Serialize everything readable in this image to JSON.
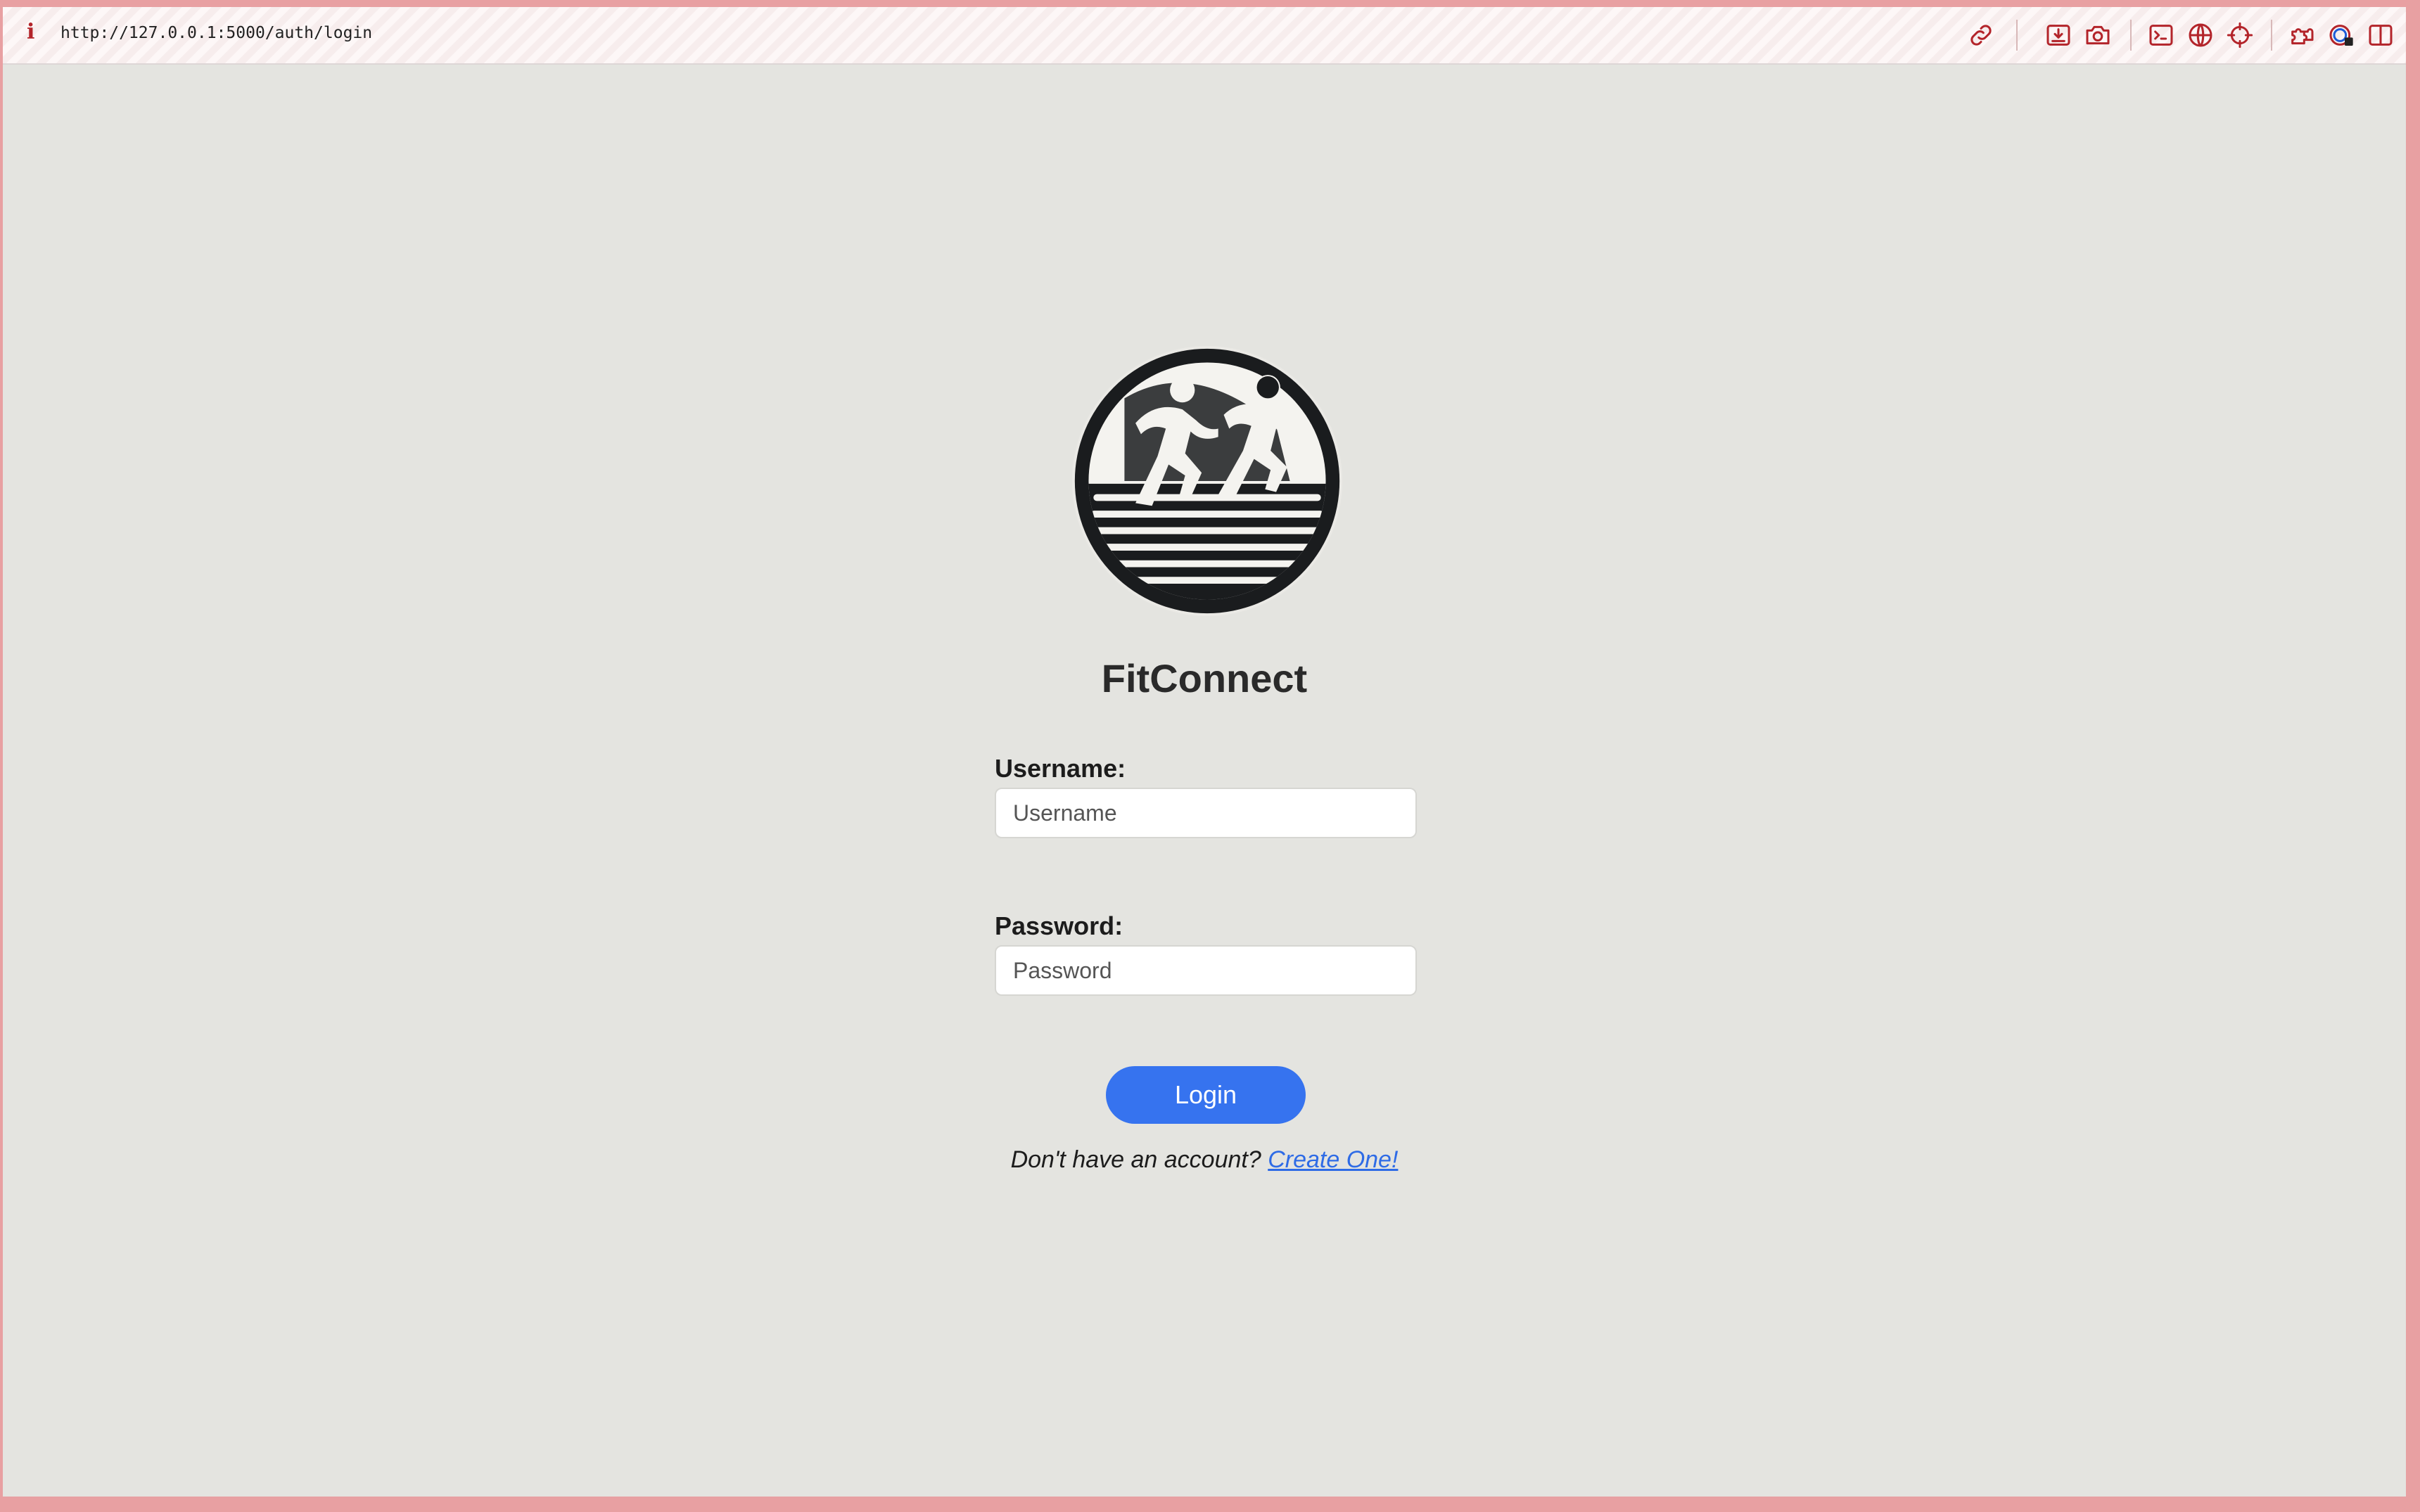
{
  "browser": {
    "url": "http://127.0.0.1:5000/auth/login",
    "info_glyph": "i",
    "toolbar_icons": [
      "link-icon",
      "download-icon",
      "camera-icon",
      "terminal-icon",
      "globe-icon",
      "crosshair-icon",
      "puzzle-icon",
      "password-manager-icon",
      "sidebar-icon"
    ],
    "accent_color": "#b3242a"
  },
  "page": {
    "app_name": "FitConnect",
    "logo_icon": "runners-logo-icon",
    "username_label": "Username:",
    "username_placeholder": "Username",
    "username_value": "",
    "password_label": "Password:",
    "password_placeholder": "Password",
    "password_value": "",
    "login_label": "Login",
    "signup_prompt": "Don't have an account?",
    "signup_link": "Create One!",
    "button_color": "#3673ef",
    "link_color": "#2e6be6",
    "background_color": "#e4e4e0"
  }
}
